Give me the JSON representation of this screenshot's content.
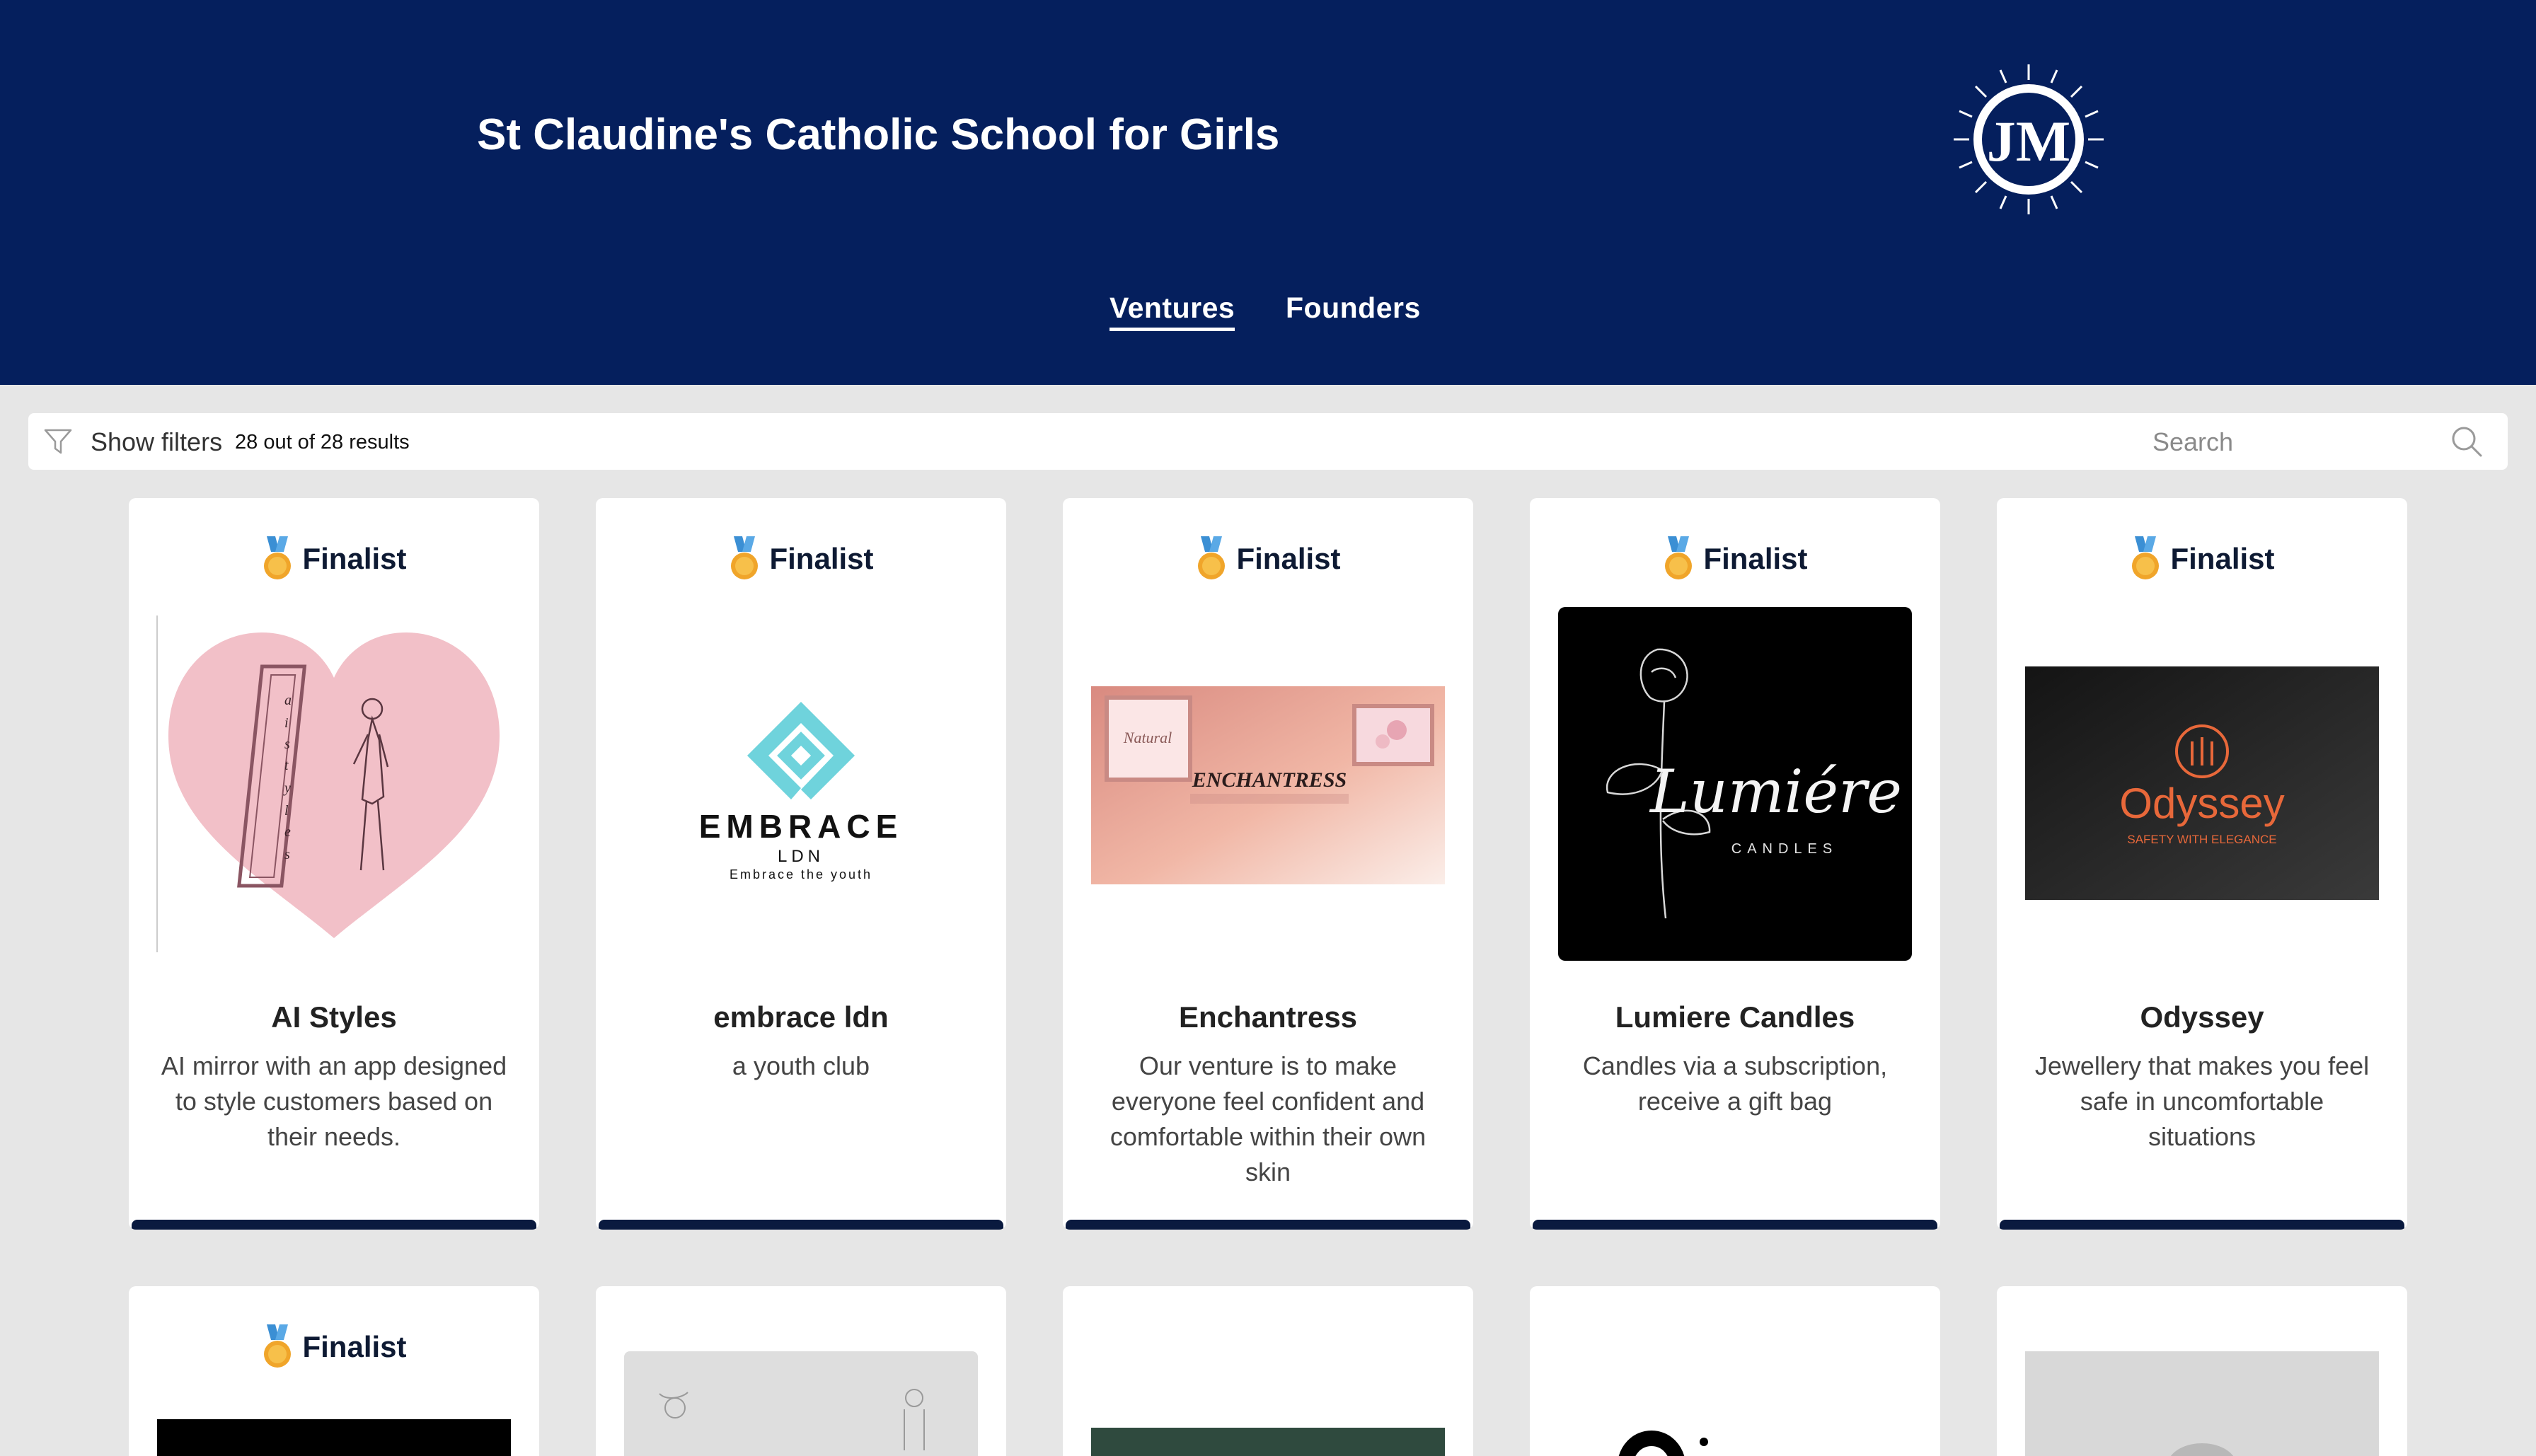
{
  "school": {
    "name": "St Claudine's Catholic School for Girls"
  },
  "nav": {
    "tabs": [
      {
        "label": "Ventures"
      },
      {
        "label": "Founders"
      }
    ]
  },
  "toolbar": {
    "show_filters": "Show filters",
    "results": "28 out of 28 results",
    "search_placeholder": "Search"
  },
  "badge": {
    "label": "Finalist"
  },
  "ventures": [
    {
      "name": "AI Styles",
      "description": "AI mirror with an app designed to style customers based on their needs.",
      "logo_text": [
        "a",
        "i",
        "s",
        "t",
        "y",
        "l",
        "e",
        "s"
      ]
    },
    {
      "name": "embrace ldn",
      "description": "a youth club",
      "logo_text": [
        "EMBRACE",
        "LDN",
        "Embrace the youth"
      ]
    },
    {
      "name": "Enchantress",
      "description": "Our venture is to make everyone feel confident and comfortable within their own skin",
      "logo_text": [
        "Natural",
        "ENCHANTRESS"
      ]
    },
    {
      "name": "Lumiere Candles",
      "description": "Candles via a subscription, receive a gift bag",
      "logo_text": [
        "Lumiére",
        "CANDLES"
      ]
    },
    {
      "name": "Odyssey",
      "description": "Jewellery that makes you feel safe in uncomfortable situations",
      "logo_text": [
        "Odyssey",
        "SAFETY WITH ELEGANCE"
      ]
    }
  ],
  "colors": {
    "header_bg": "#051f5d",
    "page_bg": "#e6e6e6",
    "card_bar": "#0a1a3f",
    "logo_teal": "#6fd3dc",
    "odyssey_orange": "#e8683a",
    "heart_pink": "#f2c0c8"
  },
  "icons": [
    "filter-icon",
    "search-icon",
    "medal-icon",
    "school-crest"
  ]
}
